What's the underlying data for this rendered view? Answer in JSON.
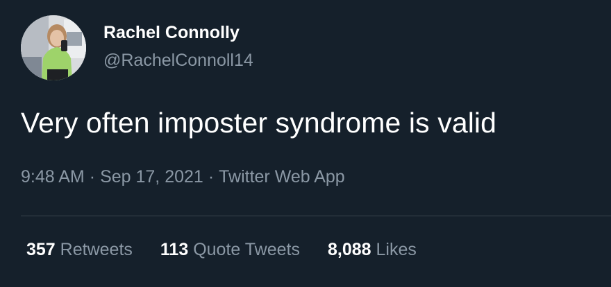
{
  "author": {
    "display_name": "Rachel Connolly",
    "handle": "@RachelConnoll14"
  },
  "tweet": {
    "text": "Very often imposter syndrome is valid"
  },
  "meta": {
    "time": "9:48 AM",
    "separator": "·",
    "date": "Sep 17, 2021",
    "source": "Twitter Web App"
  },
  "stats": [
    {
      "count": "357",
      "label": "Retweets"
    },
    {
      "count": "113",
      "label": "Quote Tweets"
    },
    {
      "count": "8,088",
      "label": "Likes"
    }
  ],
  "colors": {
    "background": "#15202b",
    "primary_text": "#ffffff",
    "secondary_text": "#8b98a5",
    "divider": "#38444d"
  }
}
